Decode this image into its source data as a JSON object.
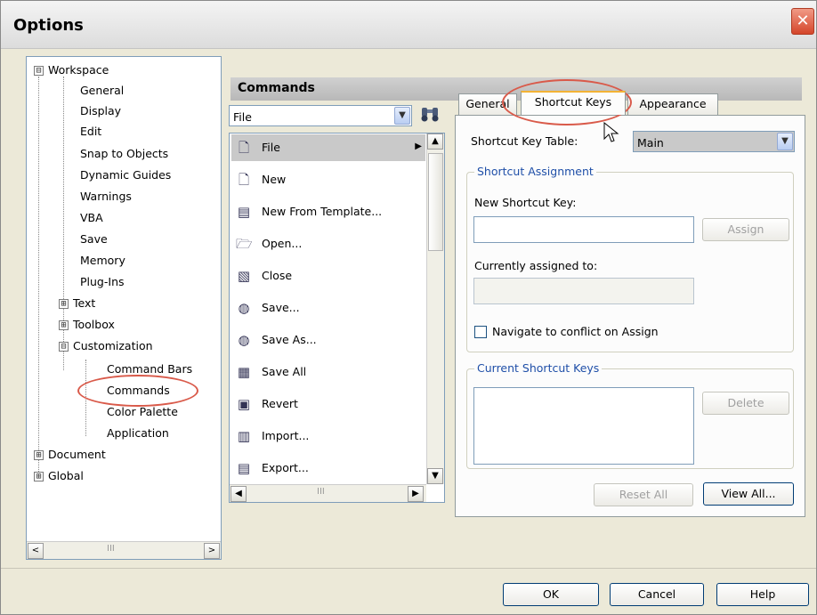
{
  "window": {
    "title": "Options",
    "close_label": "✕"
  },
  "tree": {
    "items": [
      {
        "label": "Workspace",
        "expander": "⊟"
      },
      {
        "label": "General"
      },
      {
        "label": "Display"
      },
      {
        "label": "Edit"
      },
      {
        "label": "Snap to Objects"
      },
      {
        "label": "Dynamic Guides"
      },
      {
        "label": "Warnings"
      },
      {
        "label": "VBA"
      },
      {
        "label": "Save"
      },
      {
        "label": "Memory"
      },
      {
        "label": "Plug-Ins"
      },
      {
        "label": "Text",
        "expander": "⊞"
      },
      {
        "label": "Toolbox",
        "expander": "⊞"
      },
      {
        "label": "Customization",
        "expander": "⊟"
      },
      {
        "label": "Command Bars"
      },
      {
        "label": "Commands"
      },
      {
        "label": "Color Palette"
      },
      {
        "label": "Application"
      },
      {
        "label": "Document",
        "expander": "⊞"
      },
      {
        "label": "Global",
        "expander": "⊞"
      }
    ],
    "scroll_left": "<",
    "scroll_right": ">",
    "scroll_grip": "III"
  },
  "commands": {
    "header": "Commands",
    "category_value": "File",
    "list": [
      {
        "label": "File",
        "icon": "file-icon",
        "has_submenu": true
      },
      {
        "label": "New",
        "icon": "new-document-icon"
      },
      {
        "label": "New From Template...",
        "icon": "template-icon"
      },
      {
        "label": "Open...",
        "icon": "open-icon"
      },
      {
        "label": "Close",
        "icon": "close-document-icon"
      },
      {
        "label": "Save...",
        "icon": "save-icon"
      },
      {
        "label": "Save As...",
        "icon": "save-as-icon"
      },
      {
        "label": "Save All",
        "icon": "save-all-icon"
      },
      {
        "label": "Revert",
        "icon": "revert-icon"
      },
      {
        "label": "Import...",
        "icon": "import-icon"
      },
      {
        "label": "Export...",
        "icon": "export-icon"
      }
    ]
  },
  "tabs": [
    {
      "label": "General"
    },
    {
      "label": "Shortcut Keys",
      "active": true
    },
    {
      "label": "Appearance"
    }
  ],
  "shortcut": {
    "table_label": "Shortcut Key Table:",
    "table_value": "Main",
    "assignment_group": "Shortcut Assignment",
    "new_key_label": "New Shortcut Key:",
    "assign_button": "Assign",
    "currently_label": "Currently assigned to:",
    "navigate_label": "Navigate to conflict on Assign",
    "current_group": "Current Shortcut Keys",
    "delete_button": "Delete",
    "reset_all_button": "Reset All",
    "view_all_button": "View All..."
  },
  "footer": {
    "ok": "OK",
    "cancel": "Cancel",
    "help": "Help"
  },
  "colors": {
    "highlight": "#d95a4a",
    "group_title": "#1f4fa8",
    "active_tab_border": "#f3b335"
  }
}
